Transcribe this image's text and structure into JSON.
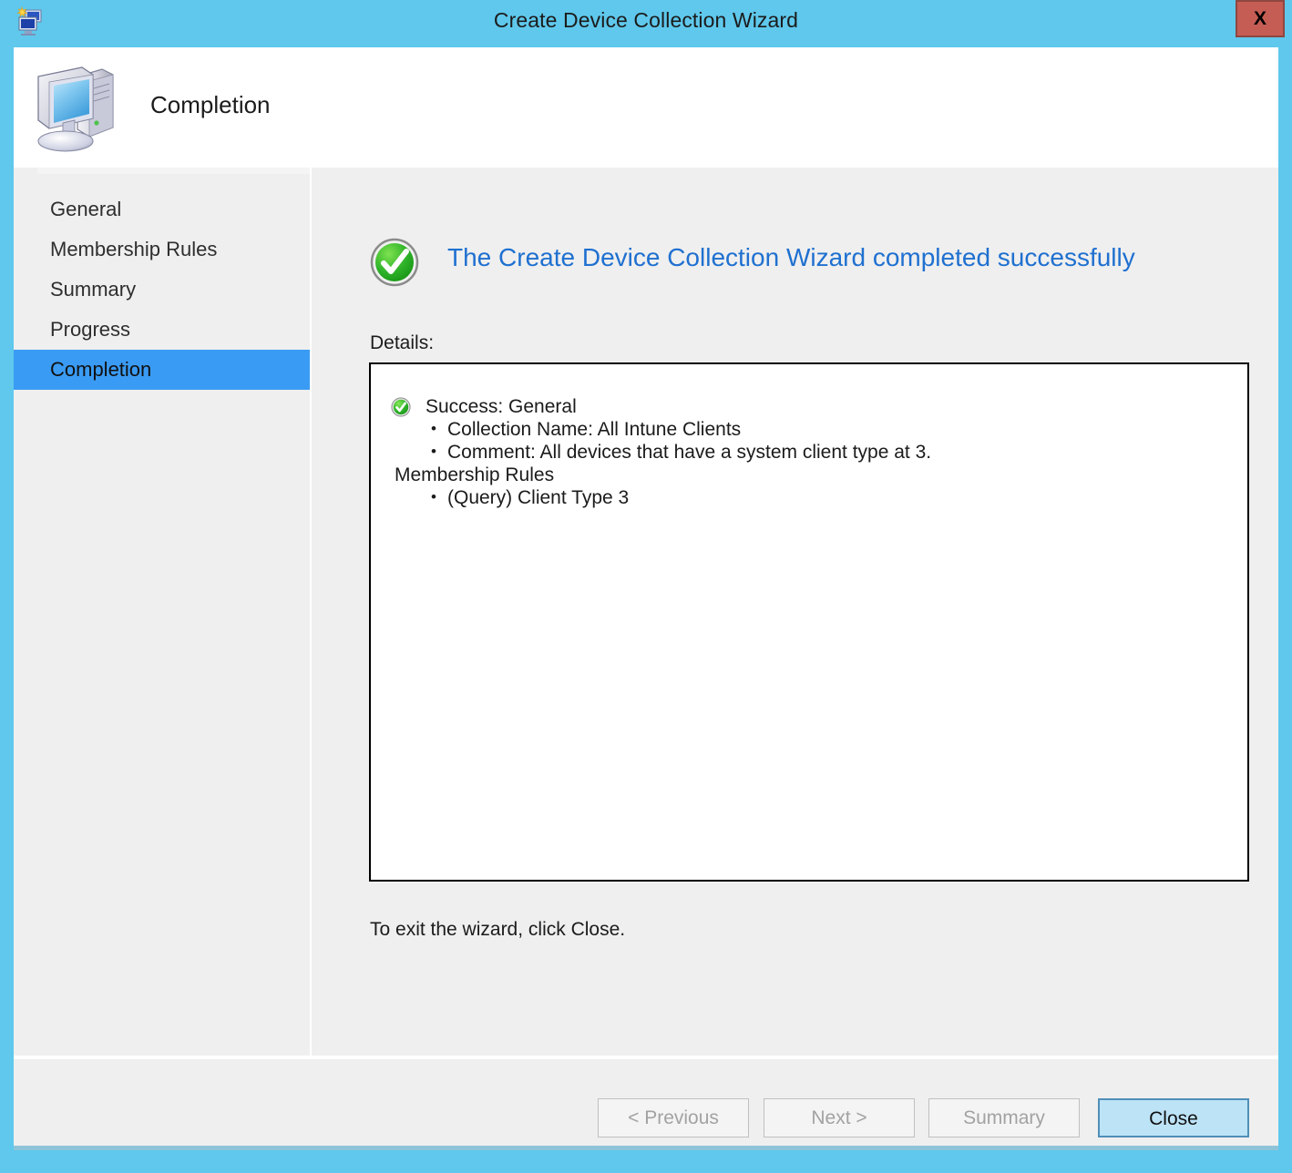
{
  "window": {
    "title": "Create Device Collection Wizard",
    "title_icon": "device-collection-icon",
    "close_label": "X",
    "frame_color": "#5fc8ec"
  },
  "header": {
    "step_title": "Completion",
    "icon": "computer-icon"
  },
  "sidebar": {
    "items": [
      {
        "label": "General",
        "selected": false
      },
      {
        "label": "Membership Rules",
        "selected": false
      },
      {
        "label": "Summary",
        "selected": false
      },
      {
        "label": "Progress",
        "selected": false
      },
      {
        "label": "Completion",
        "selected": true
      }
    ],
    "selected_color": "#3a9bf4"
  },
  "main": {
    "success_icon": "success-check-icon",
    "success_message": "The Create Device Collection Wizard completed successfully",
    "success_message_color": "#1f70d0",
    "details_label": "Details:",
    "details": [
      {
        "style": "with-icon",
        "text": "Success: General",
        "icon": "success-check-icon"
      },
      {
        "style": "bullet",
        "text": "Collection Name: All Intune Clients"
      },
      {
        "style": "bullet",
        "text": "Comment: All devices that have a system client type at 3."
      },
      {
        "style": "plain",
        "text": "Membership Rules"
      },
      {
        "style": "bullet",
        "text": "(Query) Client Type 3"
      }
    ],
    "exit_text": "To exit the wizard, click Close."
  },
  "footer": {
    "previous_label": "< Previous",
    "next_label": "Next >",
    "summary_label": "Summary",
    "close_label": "Close",
    "close_accent": "#bde3f7"
  }
}
